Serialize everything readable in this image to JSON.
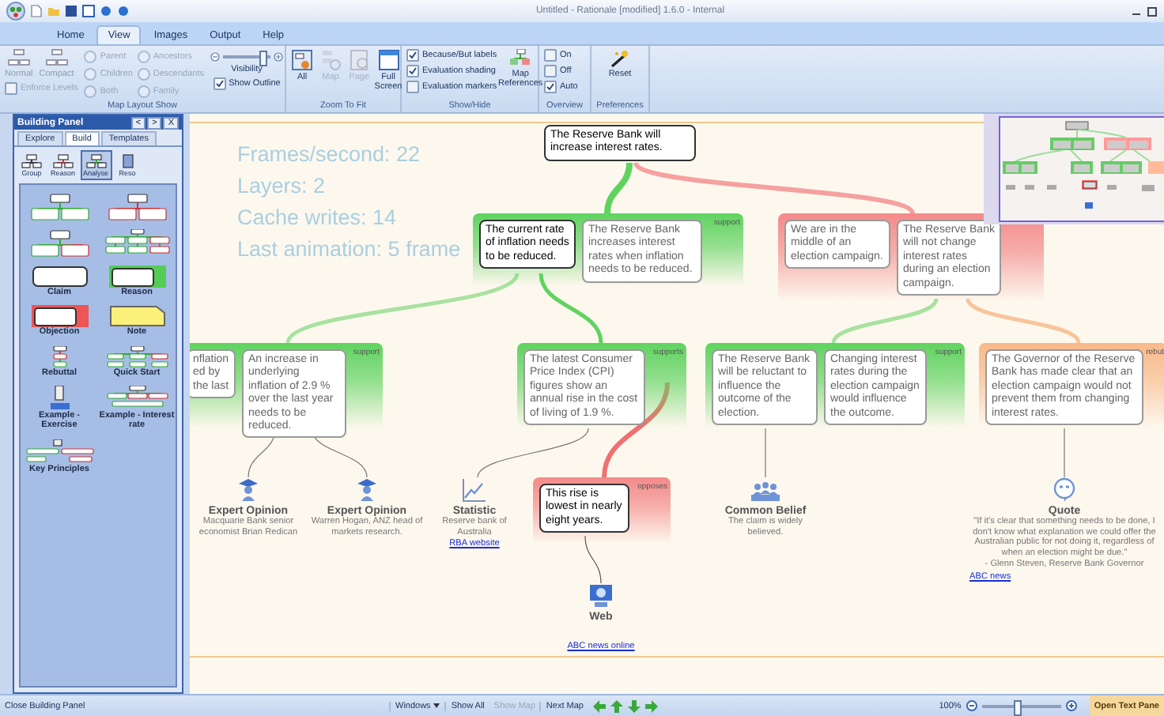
{
  "title_bar": {
    "title": "Untitled - Rationale [modified] 1.6.0 - Internal"
  },
  "menu_tabs": [
    {
      "label": "Home",
      "selected": false
    },
    {
      "label": "View",
      "selected": true
    },
    {
      "label": "Images",
      "selected": false
    },
    {
      "label": "Output",
      "selected": false
    },
    {
      "label": "Help",
      "selected": false
    }
  ],
  "ribbon": {
    "layout": {
      "title": "Map Layout Show",
      "buttons": [
        {
          "label": "Normal",
          "disabled": true
        },
        {
          "label": "Compact",
          "disabled": true
        }
      ],
      "enforce_levels": {
        "label": "Enforce Levels",
        "checked": false
      },
      "radios": [
        {
          "label": "Parent",
          "selected": false,
          "disabled": true
        },
        {
          "label": "Ancestors",
          "selected": false,
          "disabled": true
        },
        {
          "label": "Children",
          "selected": false,
          "disabled": true
        },
        {
          "label": "Descendants",
          "selected": false,
          "disabled": true
        },
        {
          "label": "Both",
          "selected": false,
          "disabled": true
        },
        {
          "label": "Family",
          "selected": false,
          "disabled": true
        }
      ],
      "visibility": {
        "label": "Visibility",
        "level": 0.82
      },
      "show_outline": {
        "label": "Show Outline",
        "checked": true
      }
    },
    "zoom": {
      "title": "Zoom To Fit",
      "buttons": [
        {
          "label": "All",
          "kind": "all",
          "disabled": false
        },
        {
          "label": "Map",
          "kind": "map",
          "disabled": true
        },
        {
          "label": "Page",
          "kind": "page",
          "disabled": true
        },
        {
          "label": "Full Screen",
          "kind": "screen",
          "disabled": false
        }
      ]
    },
    "show_hide": {
      "title": "Show/Hide",
      "checks": [
        {
          "label": "Because/But labels",
          "checked": true
        },
        {
          "label": "Evaluation shading",
          "checked": true
        },
        {
          "label": "Evaluation markers",
          "checked": false
        }
      ],
      "button": {
        "label": "Map References"
      }
    },
    "overview": {
      "title": "Overview",
      "options": [
        {
          "label": "On",
          "checked": false
        },
        {
          "label": "Off",
          "checked": false
        },
        {
          "label": "Auto",
          "checked": true
        }
      ]
    },
    "preferences": {
      "title": "Preferences",
      "button": {
        "label": "Reset"
      }
    }
  },
  "building_panel": {
    "title": "Building Panel",
    "controls": [
      "<",
      ">",
      "X"
    ],
    "tabs": [
      {
        "label": "Explore",
        "selected": false
      },
      {
        "label": "Build",
        "selected": true
      },
      {
        "label": "Templates",
        "selected": false
      }
    ],
    "subtabs": [
      {
        "label": "Group",
        "kind": "group",
        "selected": false
      },
      {
        "label": "Reason",
        "kind": "reason",
        "selected": false
      },
      {
        "label": "Analyse",
        "kind": "analyse",
        "selected": true
      },
      {
        "label": "Reso",
        "kind": "resource",
        "selected": false
      }
    ],
    "items": [
      {
        "kind": "support-tree"
      },
      {
        "kind": "oppose-tree"
      },
      {
        "kind": "mixed-tree"
      },
      {
        "kind": "wide-tree"
      },
      {
        "kind": "claim",
        "label": "Claim"
      },
      {
        "kind": "reason",
        "label": "Reason"
      },
      {
        "kind": "objection",
        "label": "Objection"
      },
      {
        "kind": "note",
        "label": "Note"
      },
      {
        "kind": "rebuttal",
        "label": "Rebuttal"
      },
      {
        "kind": "quick-start",
        "label": "Quick Start"
      },
      {
        "kind": "exercise",
        "label": "Example - Exercise"
      },
      {
        "kind": "interest",
        "label": "Example - Interest rate"
      },
      {
        "kind": "principles",
        "label": "Key Principles"
      }
    ]
  },
  "map": {
    "stats": [
      "Frames/second: 22",
      "Layers: 2",
      "Cache writes: 14",
      "Last animation: 5 frame"
    ],
    "claim": {
      "text": "The Reserve Bank will increase interest rates.",
      "selected": true
    },
    "groups": [
      {
        "kind": "support",
        "label": "support",
        "items": [
          {
            "text": "The current rate of inflation needs to be reduced.",
            "selected": true
          },
          {
            "text": "The Reserve Bank increases interest rates when inflation needs to be reduced.",
            "selected": false
          }
        ]
      },
      {
        "kind": "oppose",
        "items": [
          {
            "text": "We are in the middle of an election campaign.",
            "selected": false
          },
          {
            "text": "The Reserve Bank will not change interest rates during an election campaign.",
            "selected": false
          }
        ]
      },
      {
        "kind": "support",
        "label": "support",
        "items": [
          {
            "text": "nflation\ned by\nthe last",
            "selected": false
          },
          {
            "text": "An increase in underlying inflation of 2.9 % over the last year needs to be reduced.",
            "selected": false
          }
        ]
      },
      {
        "kind": "support",
        "label": "supports",
        "items": [
          {
            "text": "The latest Consumer Price Index (CPI) figures show an annual rise in the cost of living of 1.9 %.",
            "selected": false
          }
        ]
      },
      {
        "kind": "oppose",
        "label": "opposes",
        "items": [
          {
            "text": "This rise is lowest in nearly eight years.",
            "selected": true
          }
        ]
      },
      {
        "kind": "support",
        "label": "support",
        "items": [
          {
            "text": "The Reserve Bank will be reluctant to influence the outcome of the election.",
            "selected": false
          },
          {
            "text": "Changing interest rates during the election campaign would influence the outcome.",
            "selected": false
          }
        ]
      },
      {
        "kind": "rebuttal",
        "label": "rebut",
        "items": [
          {
            "text": "The Governor of the Reserve Bank has made clear that an election campaign would not prevent them from changing interest rates.",
            "selected": false
          }
        ]
      }
    ],
    "evidence": [
      {
        "kind": "expert",
        "title": "Expert Opinion",
        "detail": "Macquarie Bank senior economist Brian Redican"
      },
      {
        "kind": "expert",
        "title": "Expert Opinion",
        "detail": "Warren Hogan, ANZ head of markets research."
      },
      {
        "kind": "statistic",
        "title": "Statistic",
        "detail": "Reserve bank of Australia",
        "link": "RBA website"
      },
      {
        "kind": "web",
        "title": "Web",
        "link": "ABC news online"
      },
      {
        "kind": "belief",
        "title": "Common Belief",
        "detail": "The claim is widely believed."
      },
      {
        "kind": "quote",
        "title": "Quote",
        "detail": "\"If it's clear that something needs to be done, I don't know what explanation we could offer the Australian public for not doing it, regardless of when an election might be due.\"",
        "source": "- Glenn Steven, Reserve Bank Governor",
        "link": "ABC news"
      }
    ]
  },
  "status_bar": {
    "close_panel": "Close Building Panel",
    "windows": "Windows",
    "show_all": "Show All",
    "show_map": {
      "label": "Show Map",
      "disabled": true
    },
    "next_map": "Next Map",
    "zoom": "100%",
    "zoom_slider": {
      "level": 0.45
    },
    "text_pane": "Open Text Pane"
  }
}
